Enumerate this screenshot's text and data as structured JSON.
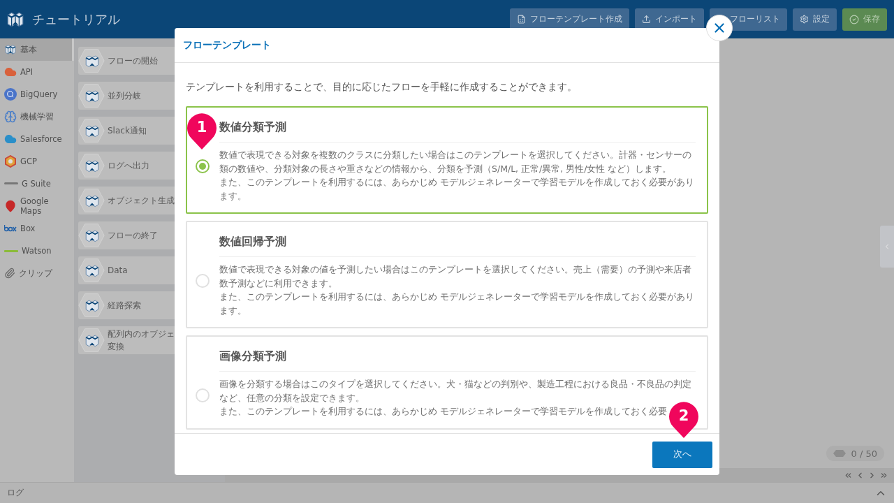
{
  "app": {
    "title": "チュートリアル"
  },
  "toolbar": [
    {
      "label": "フローテンプレート作成",
      "kind": "template"
    },
    {
      "label": "インポート",
      "kind": "import"
    },
    {
      "label": "フローリスト",
      "kind": "list"
    },
    {
      "label": "設定",
      "kind": "settings"
    },
    {
      "label": "保存",
      "kind": "save"
    }
  ],
  "categories": [
    {
      "label": "基本",
      "kind": "basic",
      "selected": true
    },
    {
      "label": "API",
      "kind": "api",
      "selected": false
    },
    {
      "label": "BigQuery",
      "kind": "bigquery",
      "selected": false
    },
    {
      "label": "機械学習",
      "kind": "ml",
      "selected": false
    },
    {
      "label": "Salesforce",
      "kind": "salesforce",
      "selected": false
    },
    {
      "label": "GCP",
      "kind": "gcp",
      "selected": false
    },
    {
      "label": "G Suite",
      "kind": "gsuite",
      "selected": false
    },
    {
      "label": "Google Maps",
      "kind": "maps",
      "selected": false
    },
    {
      "label": "Box",
      "kind": "box",
      "selected": false
    },
    {
      "label": "Watson",
      "kind": "watson",
      "selected": false
    },
    {
      "label": "クリップ",
      "kind": "clip",
      "selected": false
    }
  ],
  "blocks": [
    {
      "lines": [
        "フローの開始"
      ]
    },
    {
      "lines": [
        "並列分岐"
      ]
    },
    {
      "lines": [
        "Slack通知"
      ]
    },
    {
      "lines": [
        "ログへ出力"
      ]
    },
    {
      "lines": [
        "オブジェクト生成"
      ]
    },
    {
      "lines": [
        "フローの終了"
      ]
    },
    {
      "lines": [
        "Data"
      ]
    },
    {
      "lines": [
        "経路探索"
      ]
    },
    {
      "lines": [
        "配列内のオブジェ",
        "変換"
      ]
    }
  ],
  "modal": {
    "title": "フローテンプレート",
    "intro": "テンプレートを利用することで、目的に応じたフローを手軽に作成することができます。",
    "templates": [
      {
        "title": "数値分類予測",
        "selected": true,
        "paragraphs": [
          "数値で表現できる対象を複数のクラスに分類したい場合はこのテンプレートを選択してください。計器・センサーの類の数値や、分類対象の長さや重さなどの情報から、分類を予測（S/M/L, 正常/異常, 男性/女性 など）します。",
          "また、このテンプレートを利用するには、あらかじめ モデルジェネレーターで学習モデルを作成しておく必要があります。"
        ]
      },
      {
        "title": "数値回帰予測",
        "selected": false,
        "paragraphs": [
          "数値で表現できる対象の値を予測したい場合はこのテンプレートを選択してください。売上（需要）の予測や来店者数予測などに利用できます。",
          "また、このテンプレートを利用するには、あらかじめ モデルジェネレーターで学習モデルを作成しておく必要があります。"
        ]
      },
      {
        "title": "画像分類予測",
        "selected": false,
        "paragraphs": [
          "画像を分類する場合はこのタイプを選択してください。犬・猫などの判別や、製造工程における良品・不良品の判定など、任意の分類を設定できます。",
          "また、このテンプレートを利用するには、あらかじめ モデルジェネレーターで学習モデルを作成しておく必要"
        ]
      }
    ],
    "next_button": "次へ"
  },
  "markers": [
    "1",
    "2"
  ],
  "counter": "0 / 50",
  "log_panel": {
    "title": "ログ"
  }
}
